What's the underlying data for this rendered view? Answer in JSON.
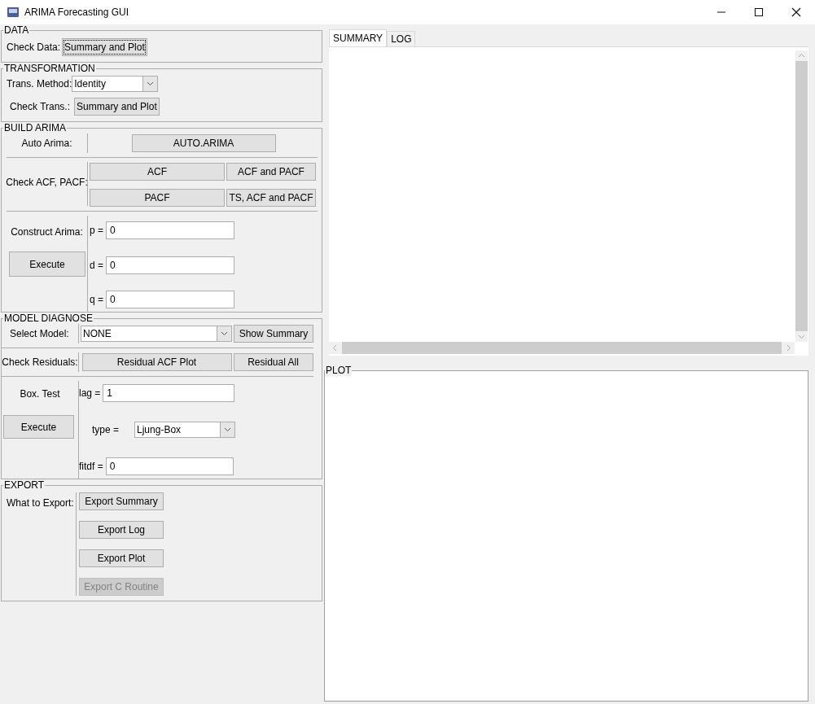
{
  "window": {
    "title": "ARIMA Forecasting GUI"
  },
  "data": {
    "title": "DATA",
    "check_label": "Check Data:",
    "check_button": {
      "label": "Summary and Plot",
      "focused": true
    }
  },
  "transformation": {
    "title": "TRANSFORMATION",
    "method_label": "Trans. Method:",
    "method_value": "Identity",
    "check_label": "Check Trans.:",
    "check_button": {
      "label": "Summary and Plot",
      "focused": false
    }
  },
  "build_arima": {
    "title": "BUILD ARIMA",
    "auto_label": "Auto Arima:",
    "auto_button": "AUTO.ARIMA",
    "acf_label": "Check ACF, PACF:",
    "acf_buttons": [
      "ACF",
      "ACF and PACF",
      "PACF",
      "TS, ACF and PACF"
    ],
    "construct_label": "Construct Arima:",
    "execute_button": "Execute",
    "params": [
      {
        "label": "p =",
        "value": "0"
      },
      {
        "label": "d =",
        "value": "0"
      },
      {
        "label": "q =",
        "value": "0"
      }
    ]
  },
  "model_diagnose": {
    "title": "MODEL DIAGNOSE",
    "select_label": "Select Model:",
    "model_value": "NONE",
    "show_button": "Show Summary",
    "residual_label": "Check Residuals:",
    "residual_buttons": [
      "Residual ACF Plot",
      "Residual All"
    ],
    "box_label": "Box. Test",
    "execute_button": "Execute",
    "lag_label": "lag =",
    "lag_value": "1",
    "type_label": "type =",
    "type_value": "Ljung-Box",
    "fitdf_label": "fitdf =",
    "fitdf_value": "0"
  },
  "export": {
    "title": "EXPORT",
    "label": "What to Export:",
    "buttons": [
      {
        "label": "Export Summary",
        "disabled": false
      },
      {
        "label": "Export Log",
        "disabled": false
      },
      {
        "label": "Export Plot",
        "disabled": false
      },
      {
        "label": "Export C Routine",
        "disabled": true
      }
    ]
  },
  "tabs": [
    {
      "label": "SUMMARY",
      "selected": true
    },
    {
      "label": "LOG",
      "selected": false
    }
  ],
  "plot": {
    "title": "PLOT"
  }
}
